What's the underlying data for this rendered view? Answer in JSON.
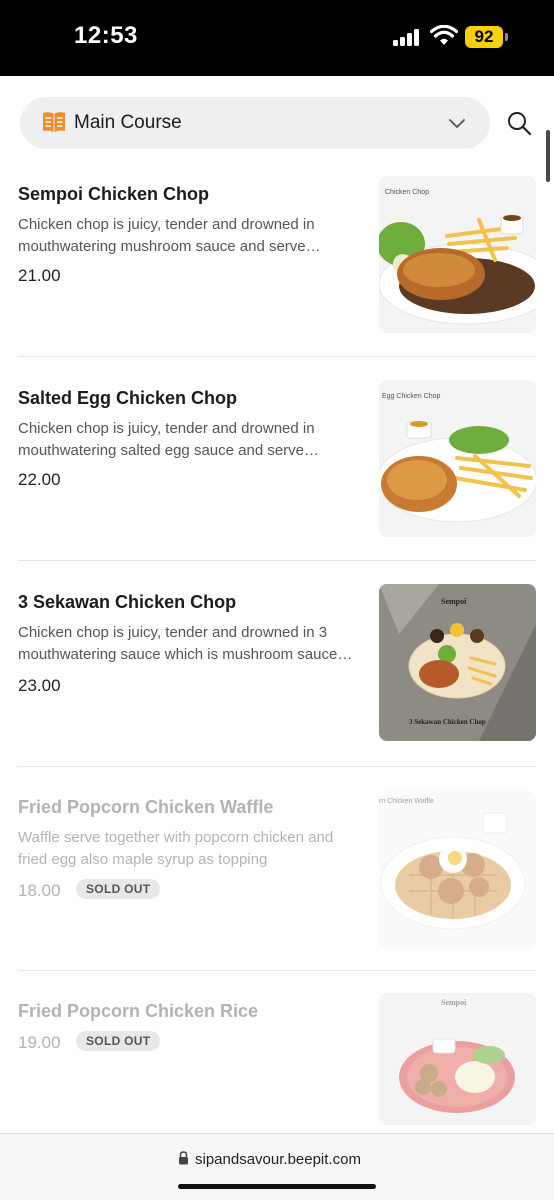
{
  "status_bar": {
    "time": "12:53",
    "battery": "92"
  },
  "header": {
    "category": "Main Course",
    "category_icon": "menu-book-icon",
    "dropdown_icon": "chevron-down-icon",
    "search_icon": "search-icon"
  },
  "menu": {
    "items": [
      {
        "name": "Sempoi Chicken Chop",
        "description": "Chicken chop is juicy, tender and drowned in mouthwatering mushroom sauce and serve…",
        "price": "21.00",
        "photo_caption": "Chicken Chop"
      },
      {
        "name": "Salted Egg Chicken Chop",
        "description": "Chicken chop is juicy, tender and drowned in mouthwatering salted egg sauce and serve…",
        "price": "22.00",
        "photo_caption": "Egg Chicken Chop"
      },
      {
        "name": "3 Sekawan Chicken Chop",
        "description": "Chicken chop is juicy, tender and drowned in 3 mouthwatering sauce which is mushroom sauce…",
        "price": "23.00",
        "photo_caption": "3 Sekawan Chicken Chop",
        "photo_brand": "Sempoi"
      },
      {
        "name": "Fried Popcorn Chicken Waffle",
        "description": "Waffle serve together with popcorn chicken and fried egg also maple syrup as topping",
        "price": "18.00",
        "badge": "SOLD OUT",
        "photo_caption": "rn Chicken Waffle"
      },
      {
        "name": "Fried Popcorn Chicken Rice",
        "price": "19.00",
        "badge": "SOLD OUT",
        "photo_brand": "Sempoi"
      }
    ]
  },
  "footer": {
    "url": "sipandsavour.beepit.com"
  },
  "colors": {
    "accent_icon": "#f28c28",
    "text": "#1c1c1c",
    "muted": "#b3b3b3"
  }
}
